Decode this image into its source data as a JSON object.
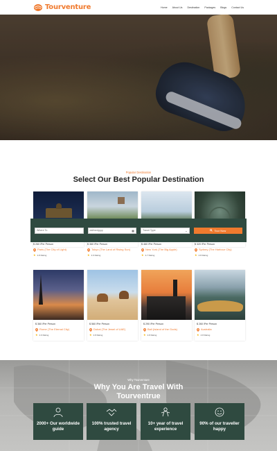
{
  "header": {
    "logo_text": "Tourventure",
    "nav": [
      "Home",
      "About Us",
      "Destination",
      "Packages",
      "Blogs",
      "Contact Us"
    ],
    "brand_color": "#f07a2e"
  },
  "popular": {
    "subtitle": "Popular Destination",
    "title": "Select Our Best Popular Destination"
  },
  "search": {
    "where_placeholder": "Where To",
    "date_value": "dd/mm/yyyy",
    "travel_type": "Travel Type",
    "button_label": "Tour Now",
    "bar_color": "#2f4a40"
  },
  "destinations": [
    {
      "price": "$ 260 /Per Person",
      "place": "Paris (The City of Light)",
      "rating": "4.8 Rating"
    },
    {
      "price": "$ 360 /Per Person",
      "place": "Tokyo (The Land of Rising Sun)",
      "rating": "4.9 Rating"
    },
    {
      "price": "$ 460 /Per Person",
      "place": "New York (The Big Apple)",
      "rating": "4.7 Rating"
    },
    {
      "price": "$ 320 /Per Person",
      "place": "Sydney (The Harbour City)",
      "rating": "4.8 Rating"
    },
    {
      "price": "$ 360 /Per Person",
      "place": "Rome (The Eternal City)",
      "rating": "4.9 Rating"
    },
    {
      "price": "$ 560 /Per Person",
      "place": "Dubai (The Jewel of UAE)",
      "rating": "4.8 Rating"
    },
    {
      "price": "$ 290 /Per Person",
      "place": "Bali (Island of the Gods)",
      "rating": "4.8 Rating"
    },
    {
      "price": "$ 260 /Per Person",
      "place": "Australia",
      "rating": "4.8 Rating"
    }
  ],
  "why": {
    "subtitle": "Why Tourventure",
    "title_line1": "Why You Are Travel With",
    "title_line2": "Tourventrue",
    "features": [
      {
        "text": "2000+ Our worldwide guide",
        "icon": "guide-icon"
      },
      {
        "text": "100% trusted travel agency",
        "icon": "handshake-icon"
      },
      {
        "text": "10+ year of travel experience",
        "icon": "traveler-icon"
      },
      {
        "text": "90% of our traveller happy",
        "icon": "happy-face-icon"
      }
    ]
  }
}
